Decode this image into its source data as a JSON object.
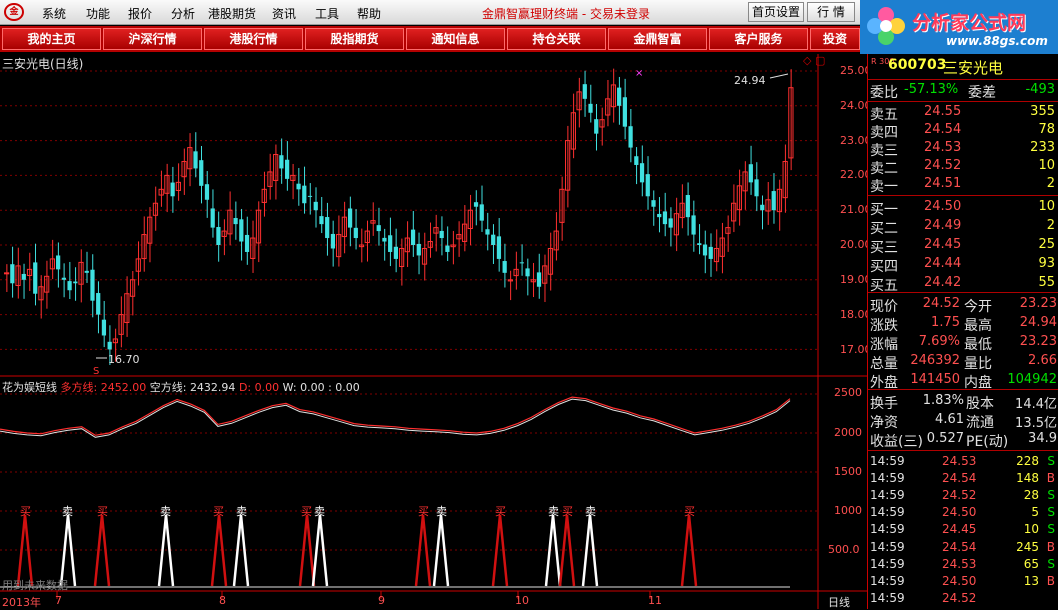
{
  "menubar": {
    "items": [
      "系统",
      "功能",
      "报价",
      "分析",
      "港股期货",
      "资讯",
      "工具",
      "帮助"
    ],
    "title": "金鼎智赢理财终端 - 交易未登录",
    "home_settings": "首页设置",
    "quote_button": "行 情"
  },
  "brand": {
    "title": "分析家公式网",
    "url": "www.88gs.com"
  },
  "nav": [
    "我的主页",
    "沪深行情",
    "港股行情",
    "股指期货",
    "通知信息",
    "持仓关联",
    "金鼎智富",
    "客户服务",
    "投资"
  ],
  "chart": {
    "main_title": "三安光电(日线)",
    "high_label": "24.94",
    "low_label": "16.70",
    "s_marker": "S",
    "y_ticks": [
      "25.00",
      "24.00",
      "23.00",
      "22.00",
      "21.00",
      "20.00",
      "19.00",
      "18.00",
      "17.00"
    ],
    "indicator": {
      "name": "花为娱短线",
      "long_label": "多方线:",
      "long_value": "2452.00",
      "short_label": "空方线:",
      "short_value": "2432.94",
      "d_label": "D:",
      "d_value": "0.00",
      "w_label": "W:",
      "w_value": "0.00",
      "extra": ": 0.00"
    },
    "ind_ticks": [
      "2500",
      "2000",
      "1500",
      "1000",
      "500.0"
    ],
    "signal_buy": "买",
    "signal_sell": "卖",
    "footer_note": "用到未来数据",
    "x_labels": [
      "2013年",
      "7",
      "8",
      "9",
      "10",
      "11"
    ],
    "period": "日线",
    "colors": {
      "up": "#ff3030",
      "down": "#40e0e0",
      "grid": "#800000"
    }
  },
  "quote": {
    "market_tag": "R 300",
    "code": "600703",
    "name": "三安光电",
    "weibi_label": "委比",
    "weibi_value": "-57.13%",
    "weicha_label": "委差",
    "weicha_value": "-493",
    "asks": [
      {
        "label": "卖五",
        "price": "24.55",
        "vol": "355"
      },
      {
        "label": "卖四",
        "price": "24.54",
        "vol": "78"
      },
      {
        "label": "卖三",
        "price": "24.53",
        "vol": "233"
      },
      {
        "label": "卖二",
        "price": "24.52",
        "vol": "10"
      },
      {
        "label": "卖一",
        "price": "24.51",
        "vol": "2"
      }
    ],
    "bids": [
      {
        "label": "买一",
        "price": "24.50",
        "vol": "10"
      },
      {
        "label": "买二",
        "price": "24.49",
        "vol": "2"
      },
      {
        "label": "买三",
        "price": "24.45",
        "vol": "25"
      },
      {
        "label": "买四",
        "price": "24.44",
        "vol": "93"
      },
      {
        "label": "买五",
        "price": "24.42",
        "vol": "55"
      }
    ],
    "stats": [
      {
        "l1": "现价",
        "v1": "24.52",
        "l2": "今开",
        "v2": "23.23"
      },
      {
        "l1": "涨跌",
        "v1": "1.75",
        "l2": "最高",
        "v2": "24.94"
      },
      {
        "l1": "涨幅",
        "v1": "7.69%",
        "l2": "最低",
        "v2": "23.23"
      },
      {
        "l1": "总量",
        "v1": "246392",
        "l2": "量比",
        "v2": "2.66"
      },
      {
        "l1": "外盘",
        "v1": "141450",
        "l2": "内盘",
        "v2": "104942"
      }
    ],
    "fund": [
      {
        "l1": "换手",
        "v1": "1.83%",
        "l2": "股本",
        "v2": "14.4亿"
      },
      {
        "l1": "净资",
        "v1": "4.61",
        "l2": "流通",
        "v2": "13.5亿"
      },
      {
        "l1": "收益(三)",
        "v1": "0.527",
        "l2": "PE(动)",
        "v2": "34.9"
      }
    ],
    "ticks": [
      {
        "t": "14:59",
        "p": "24.53",
        "v": "228",
        "s": "S"
      },
      {
        "t": "14:59",
        "p": "24.54",
        "v": "148",
        "s": "B"
      },
      {
        "t": "14:59",
        "p": "24.52",
        "v": "28",
        "s": "S"
      },
      {
        "t": "14:59",
        "p": "24.50",
        "v": "5",
        "s": "S"
      },
      {
        "t": "14:59",
        "p": "24.45",
        "v": "10",
        "s": "S"
      },
      {
        "t": "14:59",
        "p": "24.54",
        "v": "245",
        "s": "B"
      },
      {
        "t": "14:59",
        "p": "24.53",
        "v": "65",
        "s": "S"
      },
      {
        "t": "14:59",
        "p": "24.50",
        "v": "13",
        "s": "B"
      },
      {
        "t": "14:59",
        "p": "24.52",
        "v": "",
        "s": ""
      }
    ]
  }
}
